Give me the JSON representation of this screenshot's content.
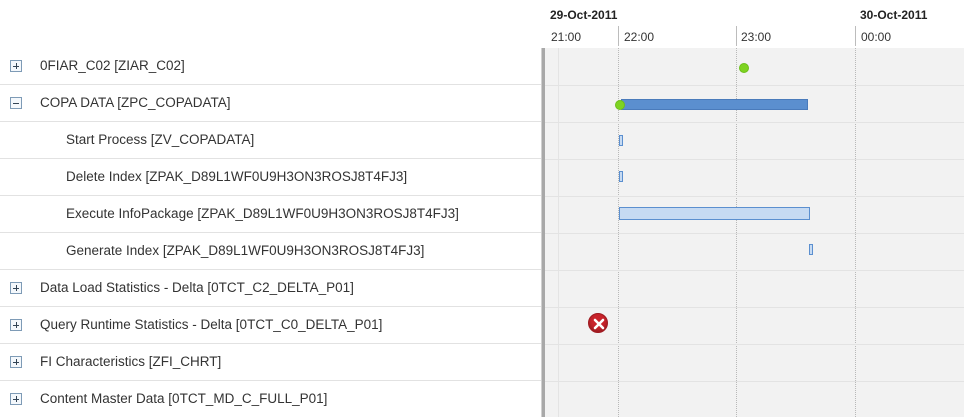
{
  "timeline": {
    "dates": [
      "29-Oct-2011",
      "30-Oct-2011"
    ],
    "hours": [
      "21:00",
      "22:00",
      "23:00",
      "00:00"
    ]
  },
  "rows": [
    {
      "label": "0FIAR_C02 [ZIAR_C02]",
      "expander": "plus"
    },
    {
      "label": "COPA DATA [ZPC_COPADATA]",
      "expander": "minus"
    },
    {
      "label": "Start Process [ZV_COPADATA]",
      "expander": "none"
    },
    {
      "label": "Delete Index [ZPAK_D89L1WF0U9H3ON3ROSJ8T4FJ3]",
      "expander": "none"
    },
    {
      "label": "Execute InfoPackage [ZPAK_D89L1WF0U9H3ON3ROSJ8T4FJ3]",
      "expander": "none"
    },
    {
      "label": "Generate Index [ZPAK_D89L1WF0U9H3ON3ROSJ8T4FJ3]",
      "expander": "none"
    },
    {
      "label": "Data Load Statistics - Delta [0TCT_C2_DELTA_P01]",
      "expander": "plus"
    },
    {
      "label": "Query Runtime Statistics - Delta [0TCT_C0_DELTA_P01]",
      "expander": "plus"
    },
    {
      "label": "FI Characteristics [ZFI_CHRT]",
      "expander": "plus"
    },
    {
      "label": "Content Master Data [0TCT_MD_C_FULL_P01]",
      "expander": "plus"
    }
  ],
  "colors": {
    "bar_dark": "#5b8fcf",
    "bar_light": "#c6daf2",
    "success_dot": "#7ed321",
    "error": "#c9232b"
  },
  "icons": {
    "success": "green-dot-icon",
    "error": "error-x-icon"
  }
}
